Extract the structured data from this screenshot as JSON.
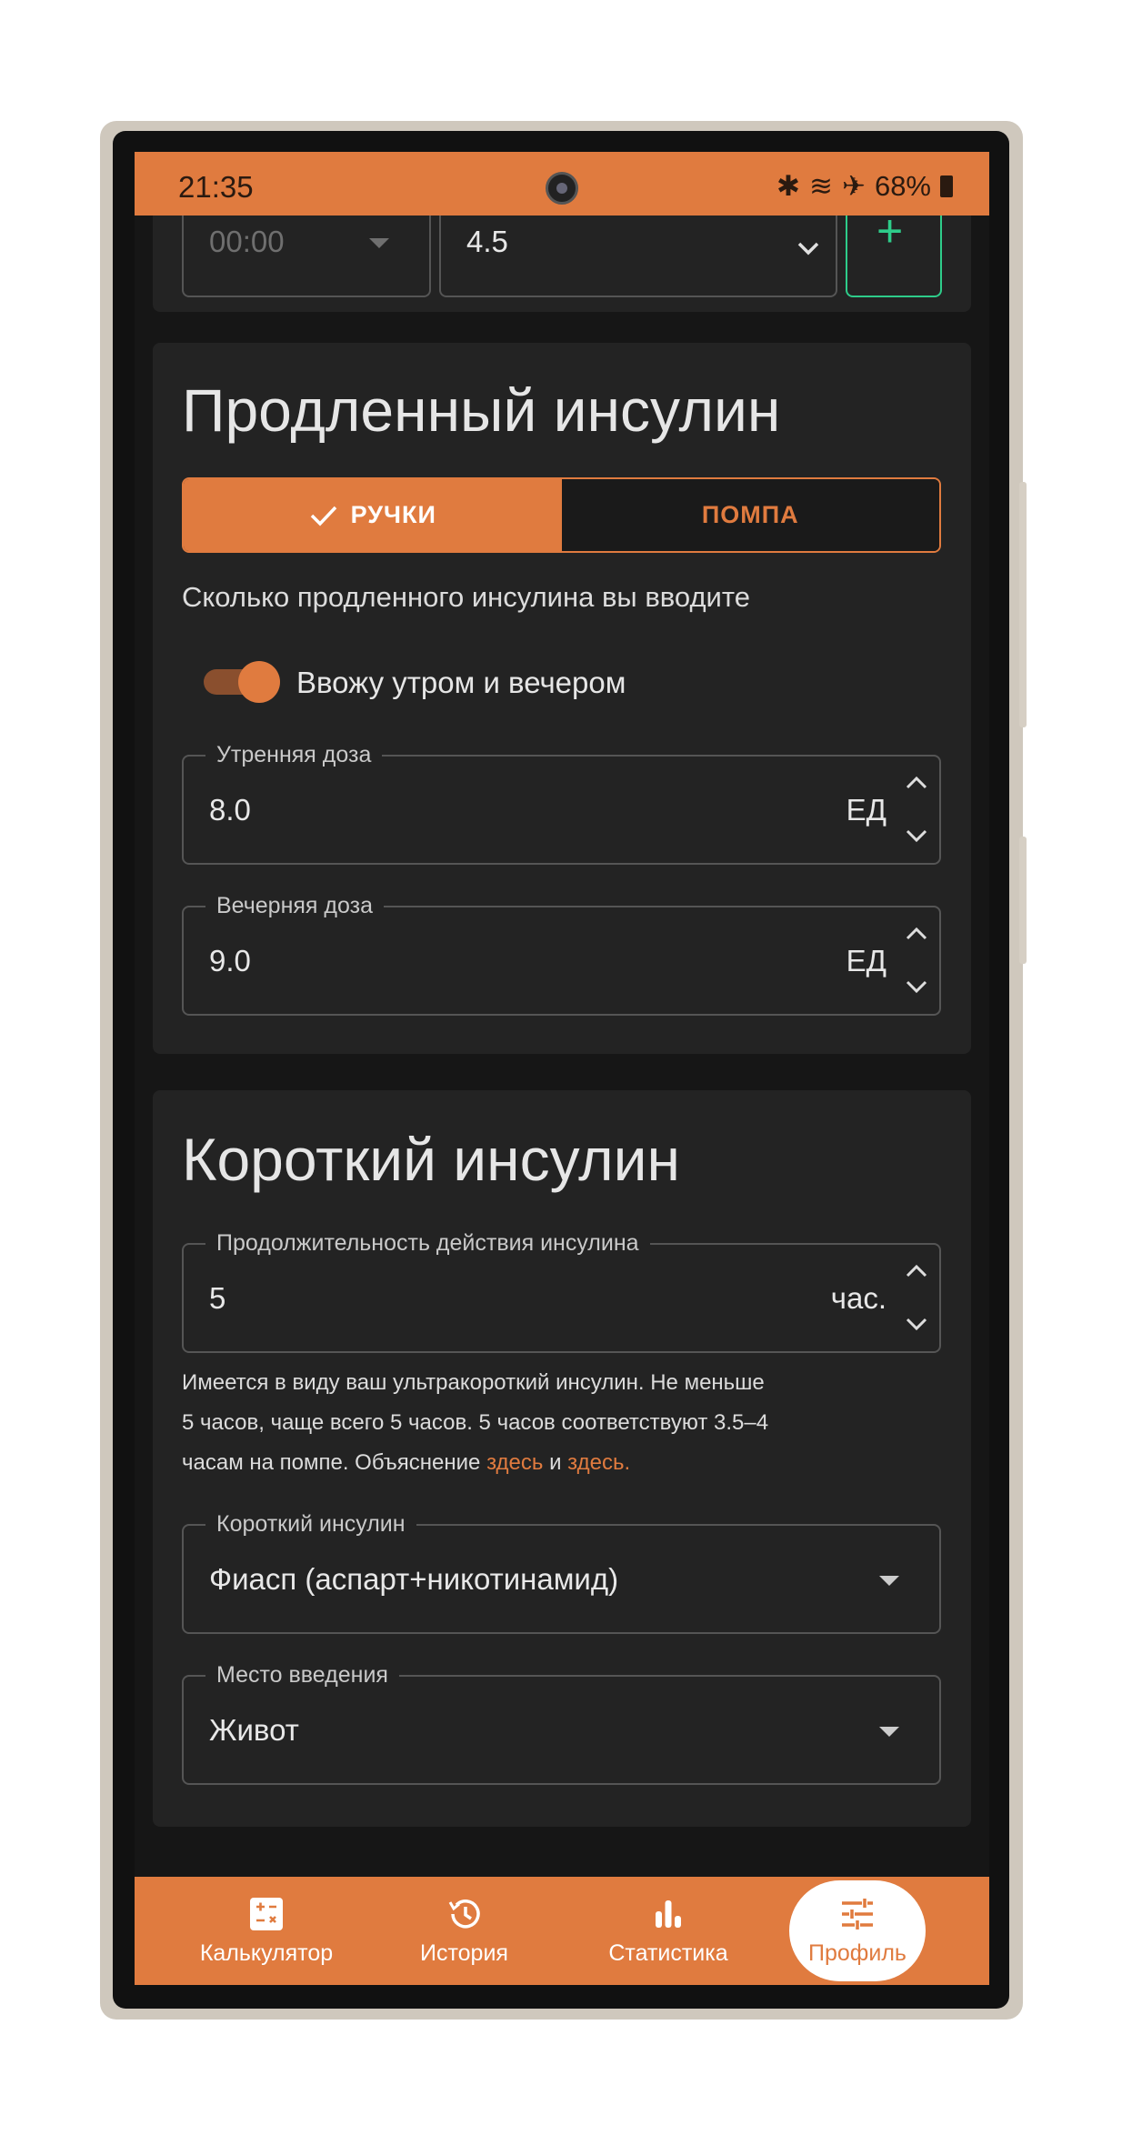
{
  "status_bar": {
    "time": "21:35",
    "battery": "68%",
    "icons": [
      "bluetooth-icon",
      "wifi-icon",
      "airplane-icon",
      "battery-icon"
    ]
  },
  "top_card": {
    "time_value": "00:00",
    "dose_value": "4.5",
    "add_label": "+"
  },
  "extended": {
    "title": "Продленный инсулин",
    "tabs": [
      {
        "label": "РУЧКИ",
        "selected": true
      },
      {
        "label": "ПОМПА",
        "selected": false
      }
    ],
    "question": "Сколько продленного инсулина вы вводите",
    "switch_label": "Ввожу утром и вечером",
    "switch_on": true,
    "morning": {
      "label": "Утренняя доза",
      "value": "8.0",
      "unit": "ЕД"
    },
    "evening": {
      "label": "Вечерняя доза",
      "value": "9.0",
      "unit": "ЕД"
    }
  },
  "short": {
    "title": "Короткий инсулин",
    "duration": {
      "label": "Продолжительность действия инсулина",
      "value": "5",
      "unit": "час."
    },
    "note_lines": [
      "Имеется в виду ваш ультракороткий инсулин. Не меньше",
      "5 часов, чаще всего 5 часов. 5 часов соответствуют 3.5–4"
    ],
    "note_line3_prefix": "часам на помпе. Объяснение ",
    "link1": "здесь",
    "note_and": " и ",
    "link2": "здесь",
    "note_end": ".",
    "insulin": {
      "label": "Короткий инсулин",
      "value": "Фиасп (аспарт+никотинамид)"
    },
    "site": {
      "label": "Место введения",
      "value": "Живот"
    }
  },
  "nav": {
    "items": [
      {
        "label": "Калькулятор",
        "icon": "calculator-icon"
      },
      {
        "label": "История",
        "icon": "history-icon"
      },
      {
        "label": "Статистика",
        "icon": "bar-chart-icon"
      },
      {
        "label": "Профиль",
        "icon": "tune-icon",
        "active": true
      }
    ]
  },
  "colors": {
    "accent": "#e07b3f",
    "background": "#161616",
    "card": "#232323",
    "add_button": "#2ecc8a"
  }
}
